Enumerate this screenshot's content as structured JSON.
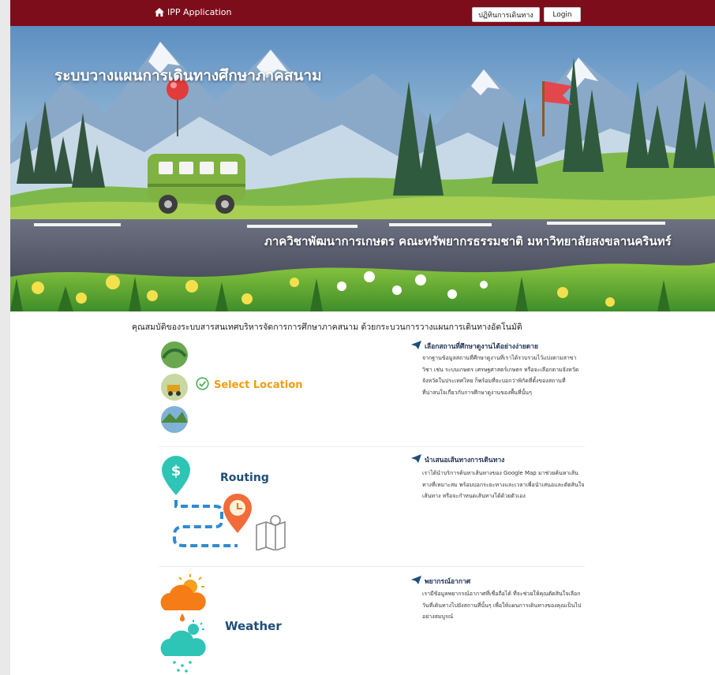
{
  "navbar": {
    "brand": "IPP Application",
    "calendar_button": "ปฏิทินการเดินทาง",
    "login_button": "Login",
    "color": "#7e0d1c"
  },
  "hero": {
    "title": "ระบบวางแผนการเดินทางศึกษาภาคสนาม",
    "subtitle": "ภาควิชาพัฒนาการเกษตร คณะทรัพยากรธรรมชาติ มหาวิทยาลัยสงขลานครินทร์"
  },
  "intro": "คุณสมบัติของระบบสารสนเทศบริหารจัดการการศึกษาภาคสนาม ด้วยกระบวนการวางแผนการเดินทางอัตโนมัติ",
  "features": [
    {
      "label": "Select Location",
      "label_color": "#f39c12",
      "heading": "เลือกสถานที่ศึกษาดูงานได้อย่างง่ายดาย",
      "desc": [
        "จากฐานข้อมูลสถานที่ศึกษาดูงานที่เราได้รวบรวมไว้แบ่งตามสาขา",
        "วิชา เช่น ระบบเกษตร เศรษฐศาสตร์เกษตร หรือจะเลือกตามจังหวัด",
        "จังหวัดในประเทศไทย ก็พร้อมที่จะบอกว่าพิกัดที่ตั้งของสถานที่",
        "ที่น่าสนใจเกี่ยวกับการศึกษาดูงานของพื้นที่นั้นๆ"
      ]
    },
    {
      "label": "Routing",
      "label_color": "#1f4e79",
      "heading": "นำเสนอเส้นทางการเดินทาง",
      "desc": [
        "เราได้นำบริการค้นหาเส้นทางของ Google Map มาช่วยค้นหาเส้น",
        "ทางที่เหมาะสม พร้อมบอกระยะทางและเวลาเพื่อนำเสนอและตัดสินใจ",
        "เส้นทาง หรือจะกำหนดเส้นทางได้ด้วยตัวเอง"
      ]
    },
    {
      "label": "Weather",
      "label_color": "#1f4e79",
      "heading": "พยากรณ์อากาศ",
      "desc": [
        "เรามีข้อมูลพยากรณ์อากาศที่เชื่อถือได้ ที่จะช่วยให้คุณตัดสินใจเลือก",
        "วันที่เดินทางไปยังสถานที่นั้นๆ เพื่อให้แผนการเดินทางของคุณเป็นไป",
        "อย่างสมบูรณ์"
      ]
    }
  ],
  "icons": {
    "brand": "home-icon",
    "feature_heading": "paper-plane-icon",
    "select_check": "check-circle-icon",
    "routing": [
      "dollar-pin-icon",
      "clock-pin-icon",
      "map-icon"
    ],
    "weather": [
      "sun-cloud-rain-icon",
      "cloud-snow-icon"
    ]
  }
}
